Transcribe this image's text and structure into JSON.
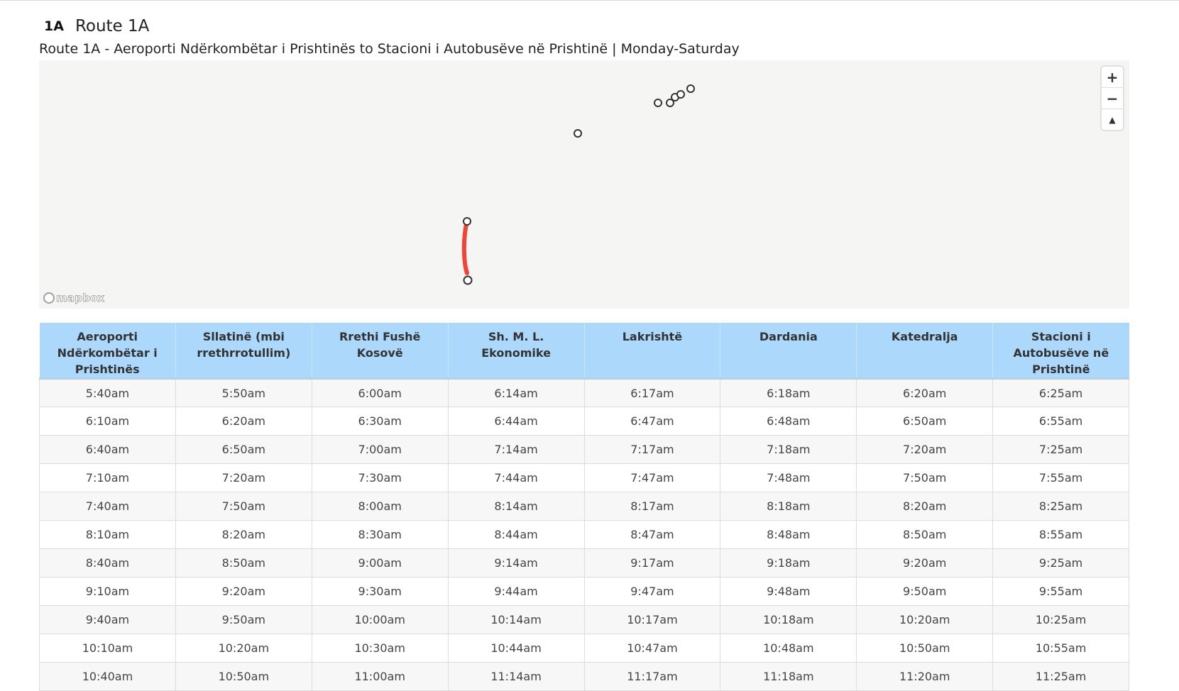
{
  "route": {
    "badge": "1A",
    "name": "Route 1A",
    "description": "Route 1A - Aeroporti Ndërkombëtar i Prishtinës to Stacioni i Autobusëve në Prishtinë | Monday-Saturday"
  },
  "map": {
    "attribution": "mapbox",
    "route_color": "#f44336",
    "zoom_in": "+",
    "zoom_out": "−",
    "compass": "▲"
  },
  "timetable": {
    "header_color": "#acd8fb",
    "headers": [
      "Aeroporti Ndërkombëtar i Prishtinës",
      "Sllatinë (mbi rrethrrotullim)",
      "Rrethi Fushë Kosovë",
      "Sh. M. L. Ekonomike",
      "Lakrishtë",
      "Dardania",
      "Katedralja",
      "Stacioni i Autobusëve në Prishtinë"
    ],
    "rows": [
      [
        "5:40am",
        "5:50am",
        "6:00am",
        "6:14am",
        "6:17am",
        "6:18am",
        "6:20am",
        "6:25am"
      ],
      [
        "6:10am",
        "6:20am",
        "6:30am",
        "6:44am",
        "6:47am",
        "6:48am",
        "6:50am",
        "6:55am"
      ],
      [
        "6:40am",
        "6:50am",
        "7:00am",
        "7:14am",
        "7:17am",
        "7:18am",
        "7:20am",
        "7:25am"
      ],
      [
        "7:10am",
        "7:20am",
        "7:30am",
        "7:44am",
        "7:47am",
        "7:48am",
        "7:50am",
        "7:55am"
      ],
      [
        "7:40am",
        "7:50am",
        "8:00am",
        "8:14am",
        "8:17am",
        "8:18am",
        "8:20am",
        "8:25am"
      ],
      [
        "8:10am",
        "8:20am",
        "8:30am",
        "8:44am",
        "8:47am",
        "8:48am",
        "8:50am",
        "8:55am"
      ],
      [
        "8:40am",
        "8:50am",
        "9:00am",
        "9:14am",
        "9:17am",
        "9:18am",
        "9:20am",
        "9:25am"
      ],
      [
        "9:10am",
        "9:20am",
        "9:30am",
        "9:44am",
        "9:47am",
        "9:48am",
        "9:50am",
        "9:55am"
      ],
      [
        "9:40am",
        "9:50am",
        "10:00am",
        "10:14am",
        "10:17am",
        "10:18am",
        "10:20am",
        "10:25am"
      ],
      [
        "10:10am",
        "10:20am",
        "10:30am",
        "10:44am",
        "10:47am",
        "10:48am",
        "10:50am",
        "10:55am"
      ],
      [
        "10:40am",
        "10:50am",
        "11:00am",
        "11:14am",
        "11:17am",
        "11:18am",
        "11:20am",
        "11:25am"
      ]
    ]
  }
}
